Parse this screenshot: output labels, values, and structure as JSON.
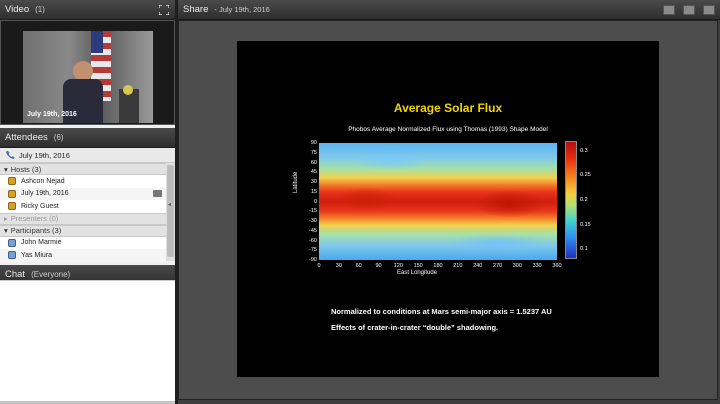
{
  "video": {
    "title": "Video",
    "count": "(1)",
    "caption": "July 19th, 2016"
  },
  "attendees": {
    "title": "Attendees",
    "count": "(6)",
    "meeting_label": "July 19th, 2016",
    "hosts_label": "Hosts (3)",
    "hosts": [
      "Ashcon Nejad",
      "July 19th, 2016",
      "Ricky Guest"
    ],
    "presenters_label": "Presenters (0)",
    "participants_label": "Participants (3)",
    "participants": [
      "John Marmie",
      "Yas Miura"
    ]
  },
  "chat": {
    "title": "Chat",
    "scope": "(Everyone)"
  },
  "share": {
    "title": "Share",
    "date": "- July 19th, 2016"
  },
  "slide": {
    "title": "Average Solar Flux",
    "subtitle": "Phobos Average Normalized Flux using Thomas (1993) Shape Model",
    "note1": "Normalized to conditions at Mars semi-major axis = 1.5237 AU",
    "note2": "Effects of crater-in-crater “double” shadowing."
  },
  "chart_data": {
    "type": "heatmap",
    "title": "Phobos Average Normalized Flux using Thomas (1993) Shape Model",
    "xlabel": "East Longitude",
    "ylabel": "Latitude",
    "x_ticks": [
      "0",
      "30",
      "60",
      "90",
      "120",
      "150",
      "180",
      "210",
      "240",
      "270",
      "300",
      "330",
      "360"
    ],
    "y_ticks": [
      "90",
      "75",
      "60",
      "45",
      "30",
      "15",
      "0",
      "-15",
      "-30",
      "-45",
      "-60",
      "-75",
      "-90"
    ],
    "colorbar_ticks": [
      "0.3",
      "0.25",
      "0.2",
      "0.15",
      "0.1"
    ],
    "xlim": [
      0,
      360
    ],
    "ylim": [
      -90,
      90
    ],
    "colorbar_range": [
      0.08,
      0.32
    ]
  }
}
